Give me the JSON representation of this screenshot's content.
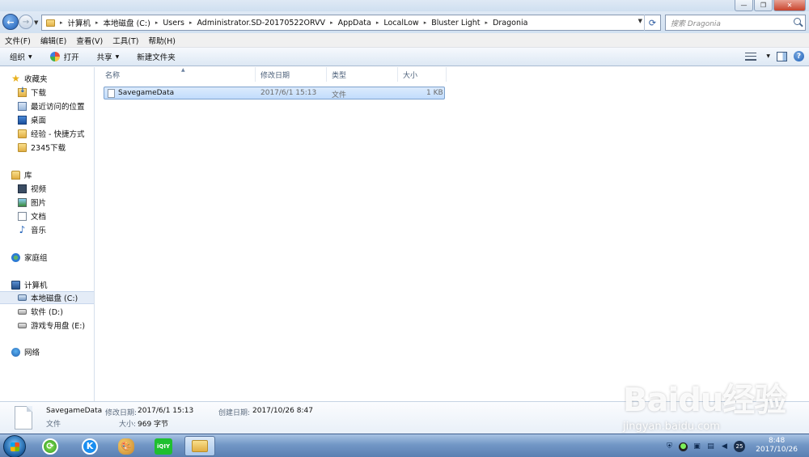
{
  "window": {
    "min_label": "—",
    "max_label": "❐",
    "close_label": "✕"
  },
  "address": {
    "root_arrow": "▸",
    "crumbs": [
      "计算机",
      "本地磁盘 (C:)",
      "Users",
      "Administrator.SD-20170522ORVV",
      "AppData",
      "LocalLow",
      "Bluster Light",
      "Dragonia"
    ],
    "separator": "▸",
    "search_placeholder": "搜索 Dragonia"
  },
  "menu": [
    "文件(F)",
    "编辑(E)",
    "查看(V)",
    "工具(T)",
    "帮助(H)"
  ],
  "toolbar": {
    "organize": "组织",
    "open": "打开",
    "share": "共享",
    "new_folder": "新建文件夹",
    "caret": "▼"
  },
  "nav": {
    "favorites": "收藏夹",
    "downloads": "下载",
    "recent": "最近访问的位置",
    "desktop": "桌面",
    "exp_shortcut": "经验 - 快捷方式",
    "dl2345": "2345下载",
    "libraries": "库",
    "videos": "视频",
    "pictures": "图片",
    "documents": "文档",
    "music": "音乐",
    "homegroup": "家庭组",
    "computer": "计算机",
    "drive_c": "本地磁盘 (C:)",
    "drive_d": "软件 (D:)",
    "drive_e": "游戏专用盘 (E:)",
    "network": "网络"
  },
  "columns": {
    "name": "名称",
    "modified": "修改日期",
    "type": "类型",
    "size": "大小",
    "sort_caret": "▲"
  },
  "files": [
    {
      "name": "SavegameData",
      "modified": "2017/6/1 15:13",
      "type": "文件",
      "size": "1 KB"
    }
  ],
  "details": {
    "name": "SavegameData",
    "type": "文件",
    "modified_label": "修改日期:",
    "modified": "2017/6/1 15:13",
    "created_label": "创建日期:",
    "created": "2017/10/26 8:47",
    "size_label": "大小:",
    "size": "969 字节"
  },
  "taskbar": {
    "time": "8:48",
    "date": "2017/10/26",
    "tray_badge": "25",
    "app_k": "K",
    "app_iqiyi": "iQIY"
  },
  "watermark": {
    "main": "Baidu经验",
    "sub": "jingyan.baidu.com"
  }
}
